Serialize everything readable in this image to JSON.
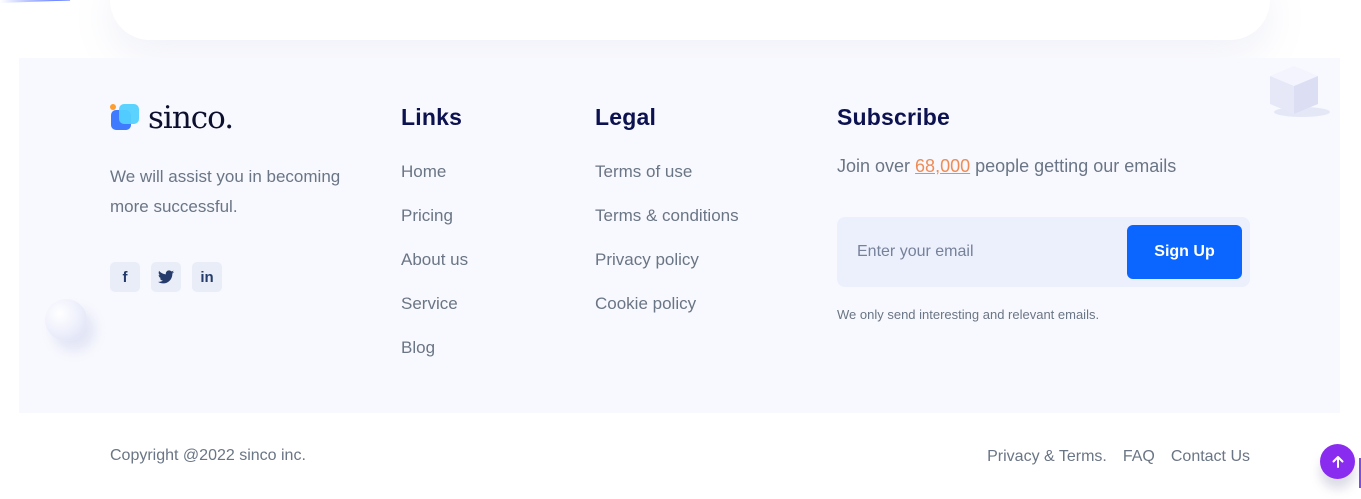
{
  "brand": {
    "name": "sinco.",
    "tagline": "We will assist you in becoming more successful."
  },
  "social": [
    {
      "icon": "facebook-icon",
      "glyph": "f"
    },
    {
      "icon": "twitter-icon",
      "glyph": ""
    },
    {
      "icon": "linkedin-icon",
      "glyph": "in"
    }
  ],
  "links": {
    "title": "Links",
    "items": [
      "Home",
      "Pricing",
      "About us",
      "Service",
      "Blog"
    ]
  },
  "legal": {
    "title": "Legal",
    "items": [
      "Terms of use",
      "Terms & conditions",
      "Privacy policy",
      "Cookie policy"
    ]
  },
  "subscribe": {
    "title": "Subscribe",
    "text_before": "Join over ",
    "count": "68,000",
    "text_after": " people getting our emails",
    "email_placeholder": "Enter your email",
    "button_label": "Sign Up",
    "note": "We only send interesting and relevant emails."
  },
  "bottom": {
    "copyright": "Copyright @2022 sinco inc.",
    "links": [
      "Privacy & Terms.",
      "FAQ",
      "Contact Us"
    ]
  },
  "colors": {
    "primary_button": "#0b66ff",
    "accent_count": "#f08b55",
    "heading": "#0c1150",
    "back_to_top": "#8a2cf0",
    "panel_bg": "#f8f9fe"
  }
}
